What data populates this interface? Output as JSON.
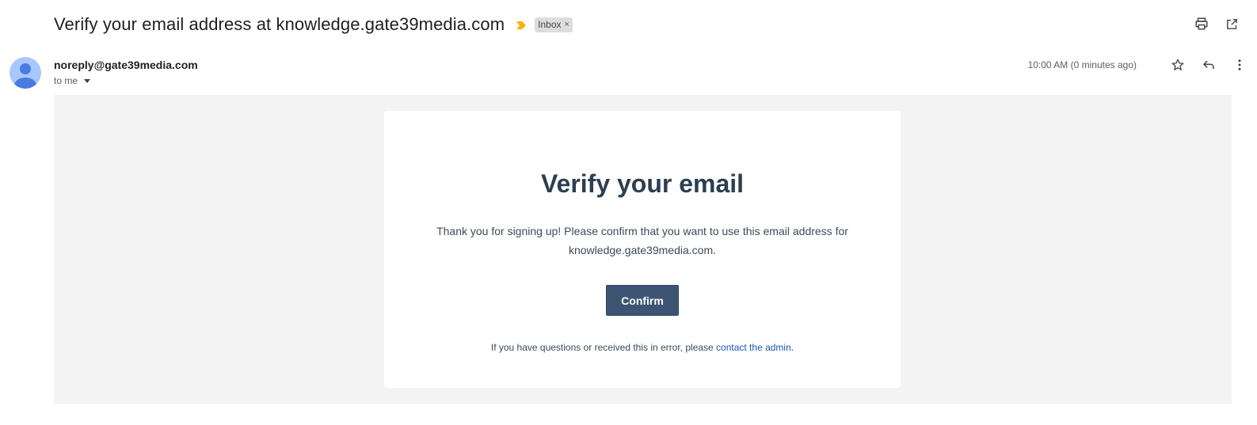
{
  "subject": {
    "title": "Verify your email address at knowledge.gate39media.com",
    "label": "Inbox",
    "label_remove": "×"
  },
  "toolbar": {
    "icons": [
      "print-icon",
      "open-in-new-window-icon"
    ]
  },
  "message": {
    "sender": "noreply@gate39media.com",
    "recipient": "to me",
    "timestamp": "10:00 AM (0 minutes ago)",
    "actions": [
      "star-icon",
      "reply-icon",
      "more-vert-icon"
    ]
  },
  "email": {
    "heading": "Verify your email",
    "intro": "Thank you for signing up! Please confirm that you want to use this email address for knowledge.gate39media.com.",
    "button_label": "Confirm",
    "footnote_prefix": "If you have questions or received this in error, please ",
    "footnote_link": "contact the admin",
    "footnote_suffix": "."
  },
  "colors": {
    "importance_marker": "#f4b400",
    "avatar_bg": "#a8c7fa",
    "avatar_fg": "#4a7ce0",
    "button_bg": "#3d5573",
    "heading": "#2c3e50",
    "link": "#1a56b0",
    "body_bg": "#f3f3f3"
  }
}
